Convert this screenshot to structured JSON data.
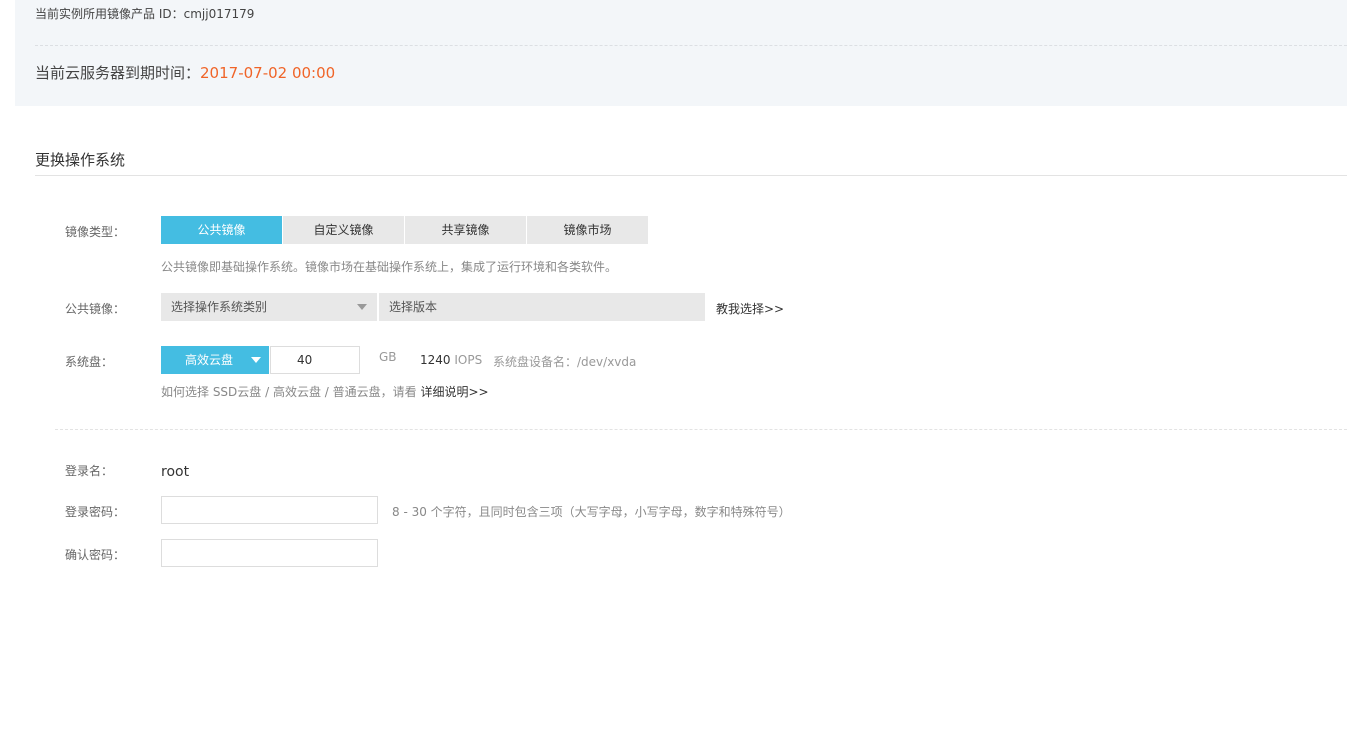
{
  "info": {
    "product_id_label": "当前实例所用镜像产品 ID：",
    "product_id": "cmjj017179",
    "expire_label": "当前云服务器到期时间：",
    "expire_value": "2017-07-02 00:00"
  },
  "section": {
    "title": "更换操作系统"
  },
  "image_type": {
    "label": "镜像类型：",
    "tabs": [
      {
        "label": "公共镜像",
        "active": true
      },
      {
        "label": "自定义镜像",
        "active": false
      },
      {
        "label": "共享镜像",
        "active": false
      },
      {
        "label": "镜像市场",
        "active": false
      }
    ],
    "hint": "公共镜像即基础操作系统。镜像市场在基础操作系统上，集成了运行环境和各类软件。"
  },
  "public_image": {
    "label": "公共镜像：",
    "os_select": "选择操作系统类别",
    "version_select": "选择版本",
    "help_link": "教我选择>>"
  },
  "system_disk": {
    "label": "系统盘：",
    "type": "高效云盘",
    "size": "40",
    "unit": "GB",
    "iops_value": "1240",
    "iops_unit": "IOPS",
    "device": "系统盘设备名：/dev/xvda",
    "hint": "如何选择 SSD云盘 / 高效云盘 / 普通云盘，请看",
    "hint_link": "详细说明>>"
  },
  "login": {
    "name_label": "登录名：",
    "name_value": "root",
    "password_label": "登录密码：",
    "password_hint": "8 - 30 个字符，且同时包含三项（大写字母，小写字母，数字和特殊符号）",
    "confirm_label": "确认密码："
  },
  "colors": {
    "accent": "#44bde2",
    "highlight": "#f06428"
  }
}
